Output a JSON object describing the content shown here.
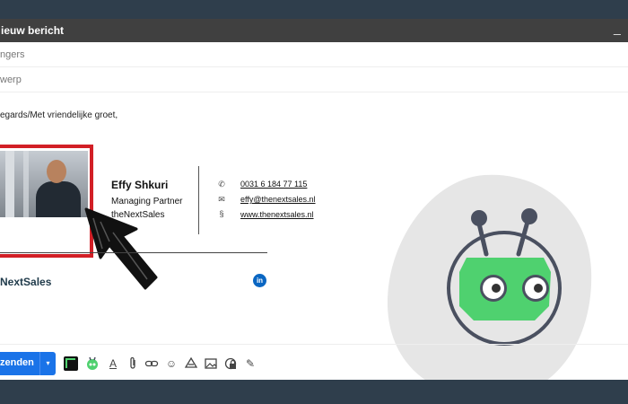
{
  "window": {
    "title": "ieuw bericht",
    "minimize_glyph": "_"
  },
  "fields": {
    "to_placeholder": "ngers",
    "subject_placeholder": "werp"
  },
  "body": {
    "greeting": "egards/Met vriendelijke groet,"
  },
  "signature": {
    "name": "Effy Shkuri",
    "role": "Managing Partner",
    "company": "theNextSales",
    "phone": "0031 6 184 77 115",
    "email": "effy@thenextsales.nl",
    "website": "www.thenextsales.nl",
    "brand": "NextSales",
    "linkedin_label": "in",
    "accent_color": "#d21f26"
  },
  "toolbar": {
    "send_label": "zenden",
    "dropdown_glyph": "▾",
    "icons": [
      "notes-app-icon",
      "robot-addon-icon",
      "text-format-icon",
      "attachment-icon",
      "link-icon",
      "emoji-icon",
      "drive-icon",
      "photo-icon",
      "confidential-icon",
      "signature-pen-icon"
    ]
  },
  "colors": {
    "background": "#2f3e4c",
    "titlebar": "#404040",
    "send_button": "#1a73e8",
    "mascot_green": "#4fd16f",
    "mascot_blob": "#e6e6e6"
  }
}
